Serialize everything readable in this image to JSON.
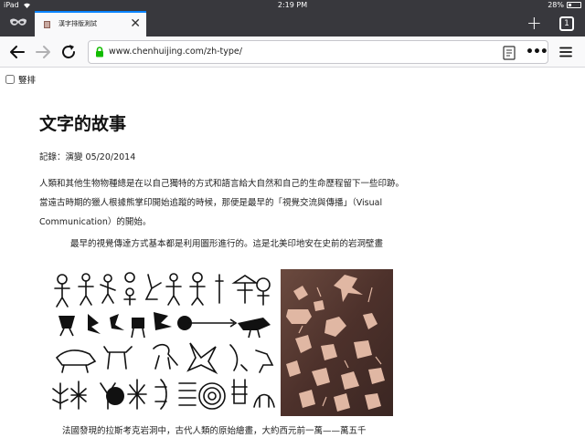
{
  "status_bar": {
    "device": "iPad",
    "time": "2:19 PM",
    "battery": "28%",
    "battery_level": 0.28
  },
  "tab": {
    "title": "漢字排版測試"
  },
  "tab_count": "1",
  "address": {
    "url": "www.chenhuijing.com/zh-type/"
  },
  "page": {
    "vertical_label": "豎排",
    "title": "文字的故事",
    "record": "記錄：演變 05/20/2014",
    "paragraph": "人類和其他生物物種總是在以自己獨特的方式和語言給大自然和自己的生命歷程留下一些印跡。當遠古時期的獵人根據熊掌印開始追蹤的時候，那便是最早的「視覺交流與傳播」（Visual Communication）的開始。",
    "caption1": "最早的視覺傳達方式基本都是利用圖形進行的。這是北美印地安在史前的岩洞壁畫",
    "caption2": "法國發現的拉斯考克岩洞中，古代人類的原始繪畫，大約西元前一萬——萬五千"
  },
  "colors": {
    "chrome": "#38383d",
    "toolbar": "#f9f9fa",
    "accent": "#0a84ff",
    "lock": "#12bc00"
  }
}
